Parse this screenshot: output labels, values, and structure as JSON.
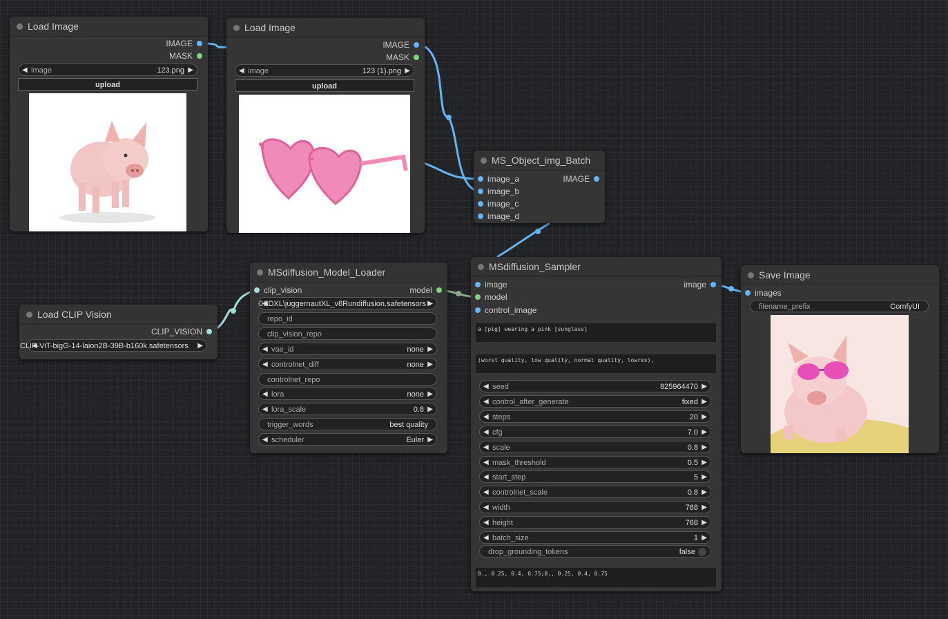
{
  "load_image_1": {
    "title": "Load Image",
    "outputs": [
      "IMAGE",
      "MASK"
    ],
    "image_label": "image",
    "image_value": "123.png",
    "upload_label": "upload"
  },
  "load_image_2": {
    "title": "Load Image",
    "outputs": [
      "IMAGE",
      "MASK"
    ],
    "image_label": "image",
    "image_value": "123 (1).png",
    "upload_label": "upload"
  },
  "batch": {
    "title": "MS_Object_img_Batch",
    "inputs": [
      "image_a",
      "image_b",
      "image_c",
      "image_d"
    ],
    "output": "IMAGE"
  },
  "clip_vision": {
    "title": "Load CLIP Vision",
    "output": "CLIP_VISION",
    "clip_name": "CLIP-ViT-bigG-14-laion2B-39B-b160k.safetensors"
  },
  "model_loader": {
    "title": "MSdiffusion_Model_Loader",
    "input": "clip_vision",
    "output": "model",
    "ckpt_value": "0SDXL\\juggernautXL_v8Rundiffusion.safetensors",
    "repo_id": "repo_id",
    "clip_vision_repo": "clip_vision_repo",
    "vae_id_label": "vae_id",
    "vae_id_value": "none",
    "controlnet_diff_label": "controlnet_diff",
    "controlnet_diff_value": "none",
    "controlnet_repo": "controlnet_repo",
    "lora_label": "lora",
    "lora_value": "none",
    "lora_scale_label": "lora_scale",
    "lora_scale_value": "0.8",
    "trigger_words_label": "trigger_words",
    "trigger_words_value": "best quality",
    "scheduler_label": "scheduler",
    "scheduler_value": "Euler"
  },
  "sampler": {
    "title": "MSdiffusion_Sampler",
    "inputs": [
      "image",
      "model",
      "control_image"
    ],
    "output": "image",
    "positive_prompt": "a [pig] wearing a pink [sunglass]",
    "negative_prompt": "(worst quality, low quality, normal quality, lowres),",
    "params": [
      {
        "label": "seed",
        "value": "825964470"
      },
      {
        "label": "control_after_generate",
        "value": "fixed"
      },
      {
        "label": "steps",
        "value": "20"
      },
      {
        "label": "cfg",
        "value": "7.0"
      },
      {
        "label": "scale",
        "value": "0.8"
      },
      {
        "label": "mask_threshold",
        "value": "0.5"
      },
      {
        "label": "start_step",
        "value": "5"
      },
      {
        "label": "controlnet_scale",
        "value": "0.8"
      },
      {
        "label": "width",
        "value": "768"
      },
      {
        "label": "height",
        "value": "768"
      },
      {
        "label": "batch_size",
        "value": "1"
      }
    ],
    "drop_label": "drop_grounding_tokens",
    "drop_value": "false",
    "role_scale": "0., 0.25, 0.4, 0.75;0., 0.25, 0.4, 0.75"
  },
  "save_image": {
    "title": "Save Image",
    "input": "images",
    "prefix_label": "filename_prefix",
    "prefix_value": "ComfyUI"
  },
  "colors": {
    "image_socket": "#64b5f6",
    "model_socket": "#7fd47f",
    "clip_wire": "#a0dede"
  }
}
